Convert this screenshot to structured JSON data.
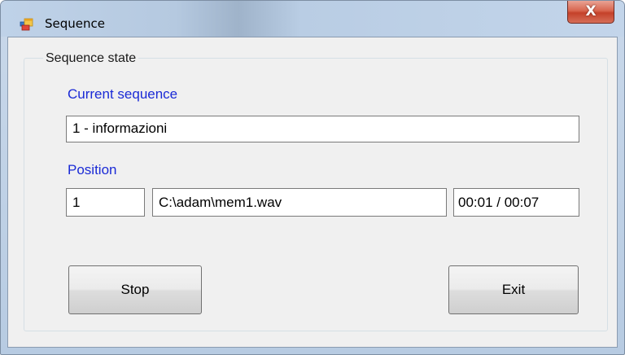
{
  "window": {
    "title": "Sequence",
    "close_glyph": "X",
    "icon": "app-window-icon"
  },
  "groupbox": {
    "title": "Sequence state"
  },
  "current_sequence": {
    "label": "Current sequence",
    "value": "1 - informazioni"
  },
  "position": {
    "label": "Position",
    "index_value": "1",
    "file_value": "C:\\adam\\mem1.wav",
    "time_value": "00:01 / 00:07"
  },
  "buttons": {
    "stop_label": "Stop",
    "exit_label": "Exit"
  },
  "colors": {
    "label_blue": "#1a2ad6",
    "close_red": "#c4412a",
    "window_bg": "#f0f0f0"
  }
}
